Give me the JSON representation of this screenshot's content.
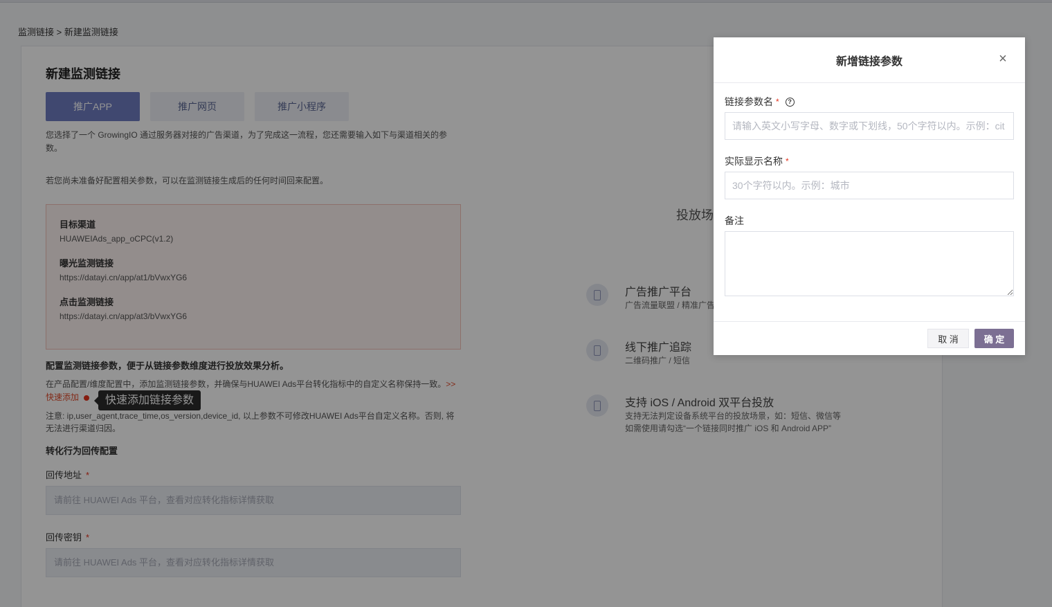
{
  "breadcrumb": "监测链接 > 新建监测链接",
  "page_title": "新建监测链接",
  "tabs": [
    {
      "label": "推广APP"
    },
    {
      "label": "推广网页"
    },
    {
      "label": "推广小程序"
    }
  ],
  "desc": "您选择了一个 GrowingIO 通过服务器对接的广告渠道，为了完成这一流程，您还需要输入如下与渠道相关的参数。",
  "desc2": "若您尚未准备好配置相关参数，可以在监测链接生成后的任何时间回来配置。",
  "info": [
    {
      "label": "目标渠道",
      "value": "HUAWEIAds_app_oCPC(v1.2)"
    },
    {
      "label": "曝光监测链接",
      "value": "https://datayi.cn/app/at1/bVwxYG6"
    },
    {
      "label": "点击监测链接",
      "value": "https://datayi.cn/app/at3/bVwxYG6"
    }
  ],
  "section_title": "配置监测链接参数，便于从链接参数维度进行投放效果分析。",
  "note1_text": "在产品配置/维度配置中，添加监测链接参数，并确保与HUAWEI Ads平台转化指标中的自定义名称保持一致。",
  "note1_link": ">>",
  "quick_add": "快速添加",
  "tooltip": "快速添加链接参数",
  "note2": "注意: ip,user_agent,trace_time,os_version,device_id, 以上参数不可修改HUAWEI Ads平台自定义名称。否则, 将无法进行渠道归因。",
  "conversion_title": "转化行为回传配置",
  "callback_url": {
    "label": "回传地址",
    "placeholder": "请前往 HUAWEI Ads 平台，查看对应转化指标详情获取"
  },
  "callback_key": {
    "label": "回传密钥",
    "placeholder": "请前往 HUAWEI Ads 平台，查看对应转化指标详情获取"
  },
  "required_mark": "*",
  "right_heading": "投放场",
  "features": [
    {
      "title": "广告推广平台",
      "desc1": "广告流量联盟 / 精准广告",
      "desc2": ""
    },
    {
      "title": "线下推广追踪",
      "desc1": "二维码推广 / 短信",
      "desc2": ""
    },
    {
      "title": "支持 iOS / Android 双平台投放",
      "desc1": "支持无法判定设备系统平台的投放场景，如：短信、微信等",
      "desc2": "如需使用请勾选“一个链接同时推广 iOS 和 Android APP”"
    }
  ],
  "modal": {
    "title": "新增链接参数",
    "close": "×",
    "help": "?",
    "param_name_label": "链接参数名",
    "param_name_placeholder": "请输入英文小写字母、数字或下划线，50个字符以内。示例：cit",
    "display_name_label": "实际显示名称",
    "display_name_placeholder": "30个字符以内。示例：城市",
    "remark_label": "备注",
    "cancel": "取 消",
    "ok": "确 定"
  }
}
